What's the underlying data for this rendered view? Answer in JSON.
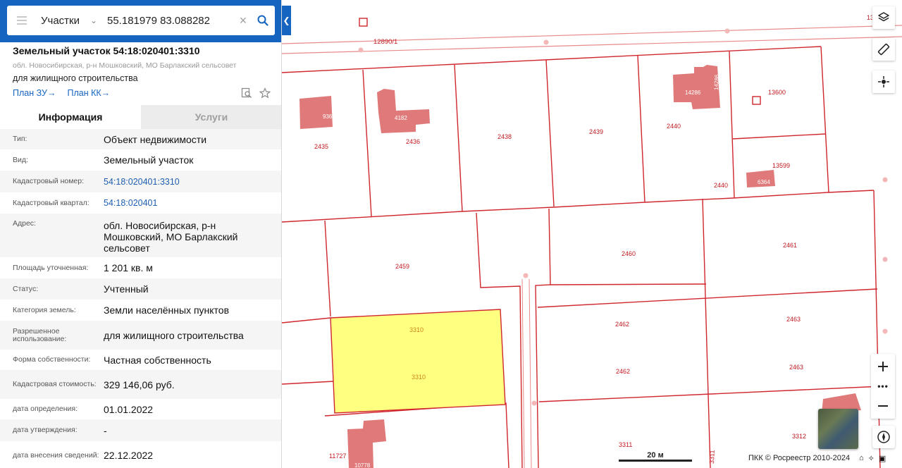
{
  "search": {
    "layer": "Участки",
    "query": "55.181979 83.088282"
  },
  "parcel": {
    "title": "Земельный участок 54:18:020401:3310",
    "address_short": "обл. Новосибирская, р-н Мошковский, МО Барлакский сельсовет",
    "purpose": "для жилищного строительства",
    "link_plan_zu": "План ЗУ",
    "link_plan_kk": "План КК"
  },
  "tabs": {
    "info": "Информация",
    "services": "Услуги"
  },
  "rows": [
    {
      "label": "Тип:",
      "value": "Объект недвижимости"
    },
    {
      "label": "Вид:",
      "value": "Земельный участок"
    },
    {
      "label": "Кадастровый номер:",
      "value": "54:18:020401:3310"
    },
    {
      "label": "Кадастровый квартал:",
      "value": "54:18:020401"
    },
    {
      "label": "Адрес:",
      "value": "обл. Новосибирская, р-н Мошковский, МО Барлакский сельсовет"
    },
    {
      "label": "Площадь уточненная:",
      "value": "1 201 кв. м"
    },
    {
      "label": "Статус:",
      "value": "Учтенный"
    },
    {
      "label": "Категория земель:",
      "value": "Земли населённых пунктов"
    },
    {
      "label": "Разрешенное использование:",
      "value": "для жилищного строительства"
    },
    {
      "label": "Форма собственности:",
      "value": "Частная собственность"
    },
    {
      "label": "Кадастровая стоимость:",
      "value": "329 146,06 руб."
    },
    {
      "label": "дата определения:",
      "value": "01.01.2022"
    },
    {
      "label": "дата утверждения:",
      "value": "-"
    },
    {
      "label": "дата внесения сведений:",
      "value": "22.12.2022"
    }
  ],
  "map": {
    "scale": "20 м",
    "attribution": "ПКК © Росреестр 2010-2024",
    "labels": {
      "road": "12890/1",
      "p9367": "9367",
      "p2435": "2435",
      "p4182": "4182",
      "p2436": "2436",
      "p2438": "2438",
      "p2439": "2439",
      "p14286": "14286",
      "p14286v": "14286",
      "p2440a": "2440",
      "p2440b": "2440",
      "p13600": "13600",
      "p13599": "13599",
      "p6364": "6364",
      "p2459": "2459",
      "p2460": "2460",
      "p2461": "2461",
      "p2462a": "2462",
      "p2462b": "2462",
      "p2463a": "2463",
      "p2463b": "2463",
      "p3310a": "3310",
      "p3310b": "3310",
      "p3311a": "3311",
      "p3311b": "3311",
      "p3312": "3312",
      "p11727": "11727",
      "p10778": "10778",
      "edge13": "13"
    }
  },
  "colors": {
    "header": "#1565c0",
    "parcel_line": "#d0262e",
    "building": "#e07a7a",
    "selected_fill": "#ffff80",
    "link": "#1565c0"
  },
  "icons": [
    "menu-icon",
    "chevron-down-icon",
    "clear-icon",
    "search-icon",
    "chevron-left-icon",
    "arrow-right-icon",
    "doc-search-icon",
    "star-icon",
    "layers-icon",
    "ruler-icon",
    "locate-icon",
    "plus-icon",
    "more-icon",
    "minus-icon",
    "compass-icon",
    "home-icon",
    "crosshair-icon",
    "fullscreen-icon"
  ]
}
